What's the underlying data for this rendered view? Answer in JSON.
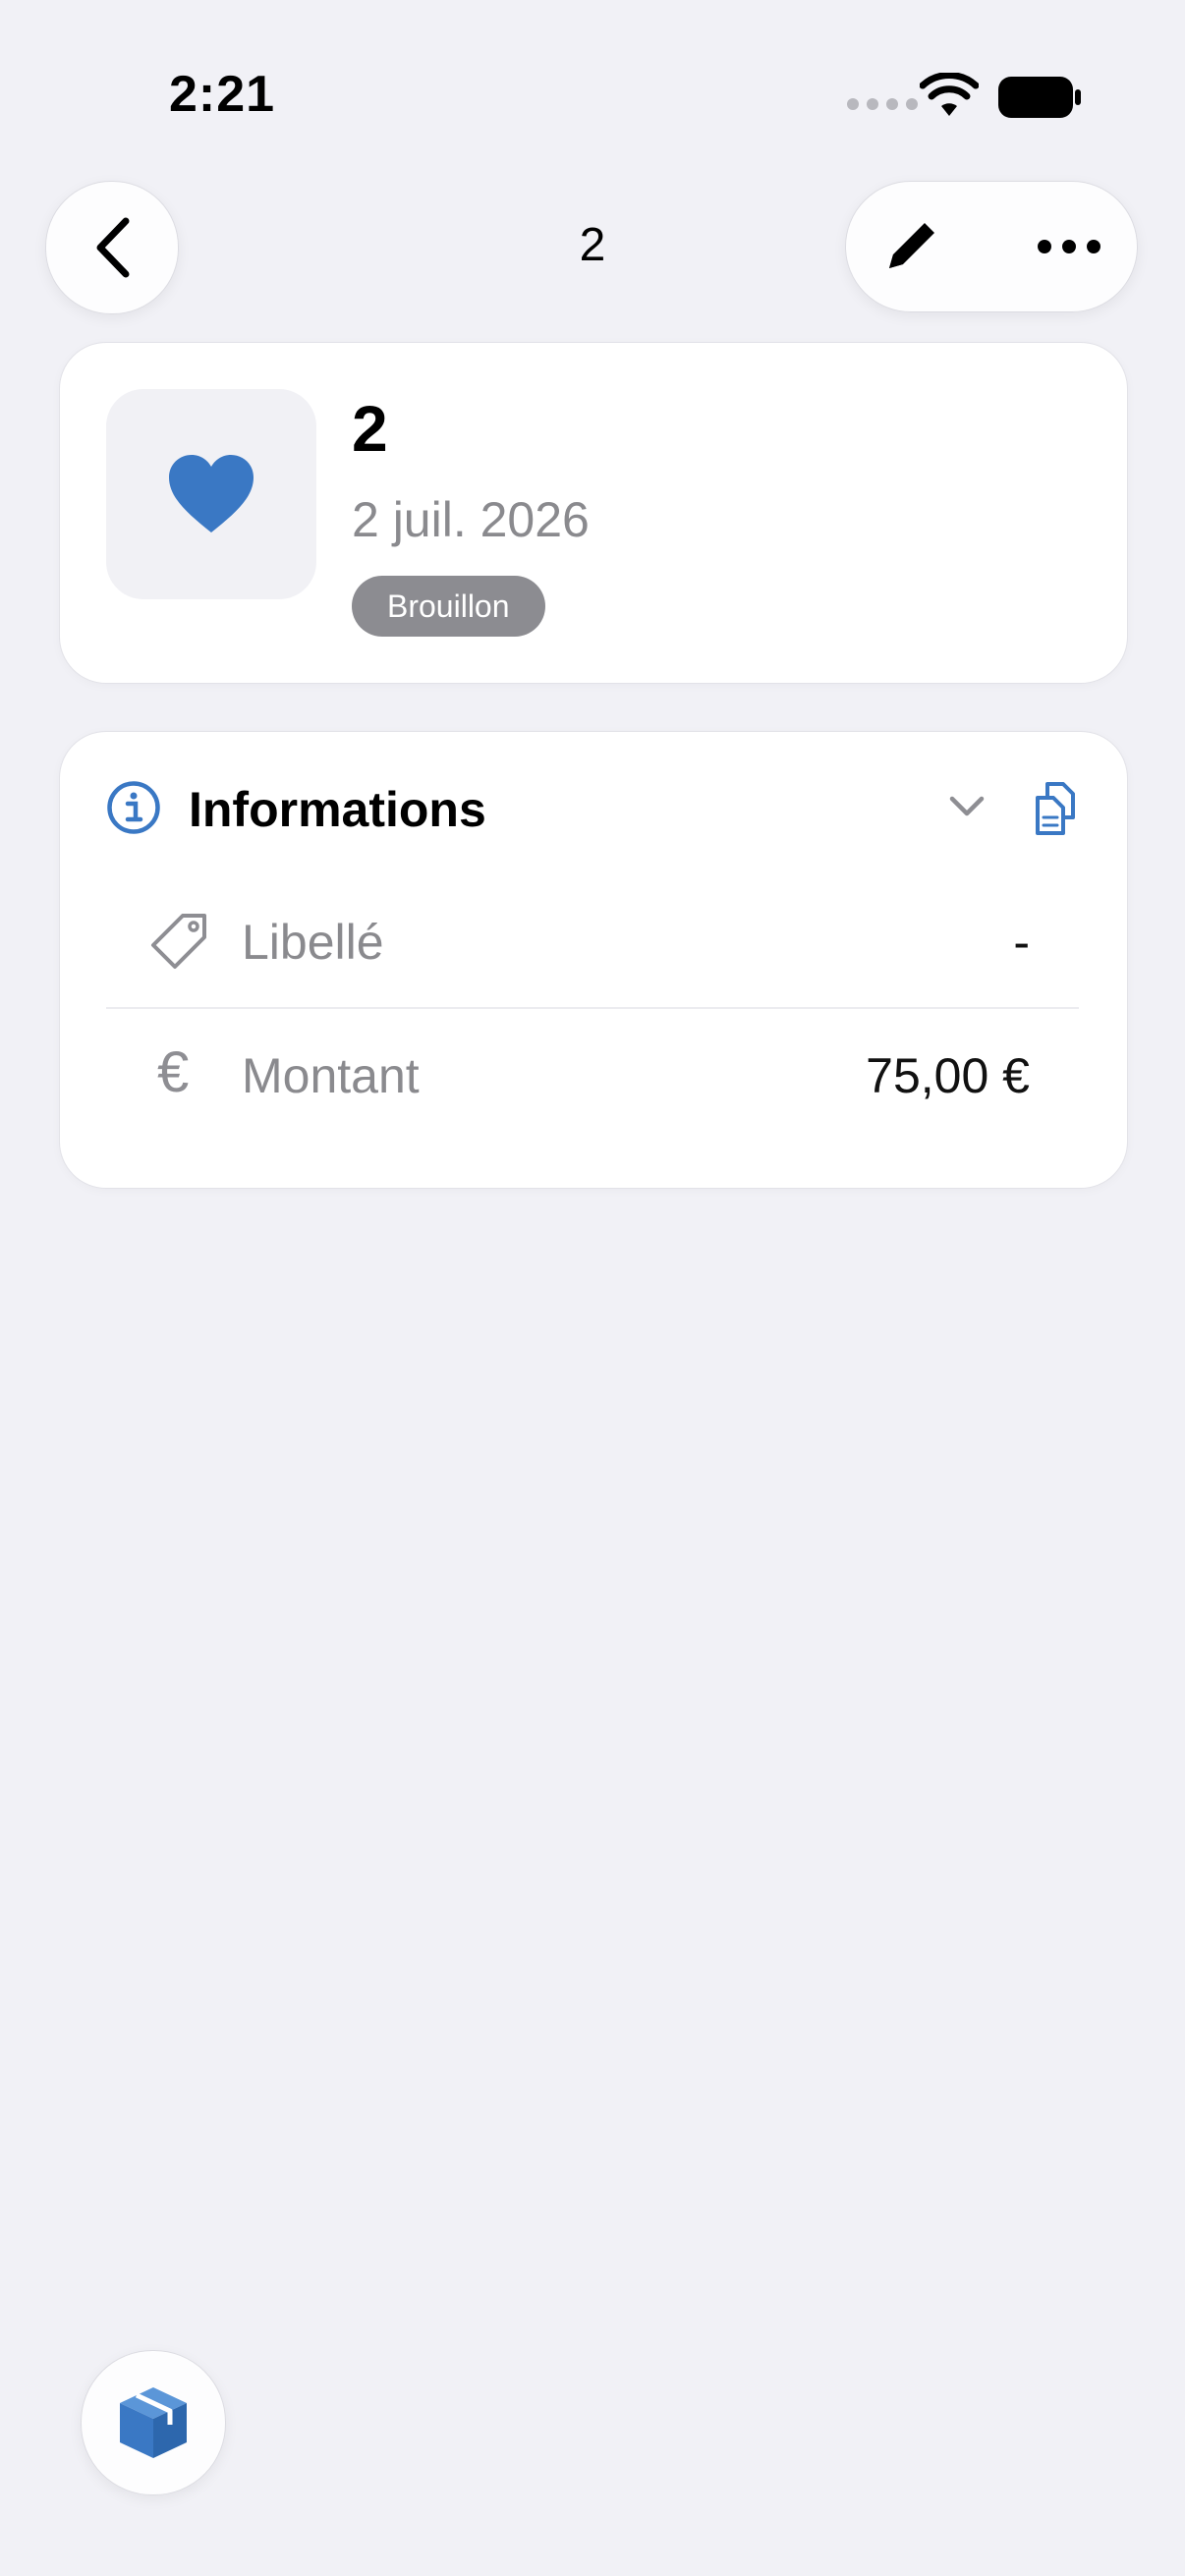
{
  "status_bar": {
    "time": "2:21"
  },
  "nav": {
    "title": "2",
    "back_icon": "chevron-left-icon",
    "edit_icon": "pencil-icon",
    "more_icon": "ellipsis-icon"
  },
  "record": {
    "title": "2",
    "date": "2 juil. 2026",
    "status": "Brouillon",
    "icon": "heart-icon"
  },
  "info_section": {
    "title": "Informations",
    "rows": [
      {
        "icon": "tag-icon",
        "label": "Libellé",
        "value": "-"
      },
      {
        "icon": "euro-icon",
        "label": "Montant",
        "value": "75,00 €",
        "icon_glyph": "€"
      }
    ]
  },
  "fab": {
    "icon": "cube-icon"
  },
  "colors": {
    "accent": "#3a78c4",
    "background": "#f1f1f6",
    "badge": "#8c8c91"
  }
}
